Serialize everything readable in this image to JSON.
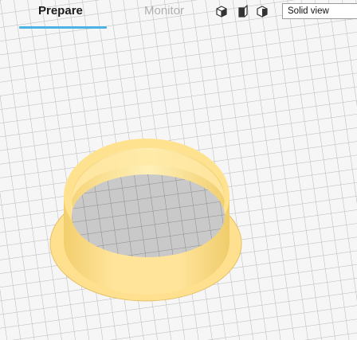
{
  "toolbar": {
    "tabs": [
      {
        "label": "Prepare",
        "active": true
      },
      {
        "label": "Monitor",
        "active": false
      }
    ],
    "view_buttons": [
      "3d-view-icon",
      "front-view-icon",
      "side-view-icon"
    ],
    "view_mode": {
      "selected": "Solid view"
    }
  },
  "scene": {
    "object": "ring-with-flange",
    "colors": {
      "object": "#ffe08e",
      "object_shade": "#e6c466",
      "grid_line": "#b9b9b9",
      "bed": "#f6f6f6",
      "hole_fill": "#c9c9c9",
      "accent": "#4db3e6"
    }
  }
}
